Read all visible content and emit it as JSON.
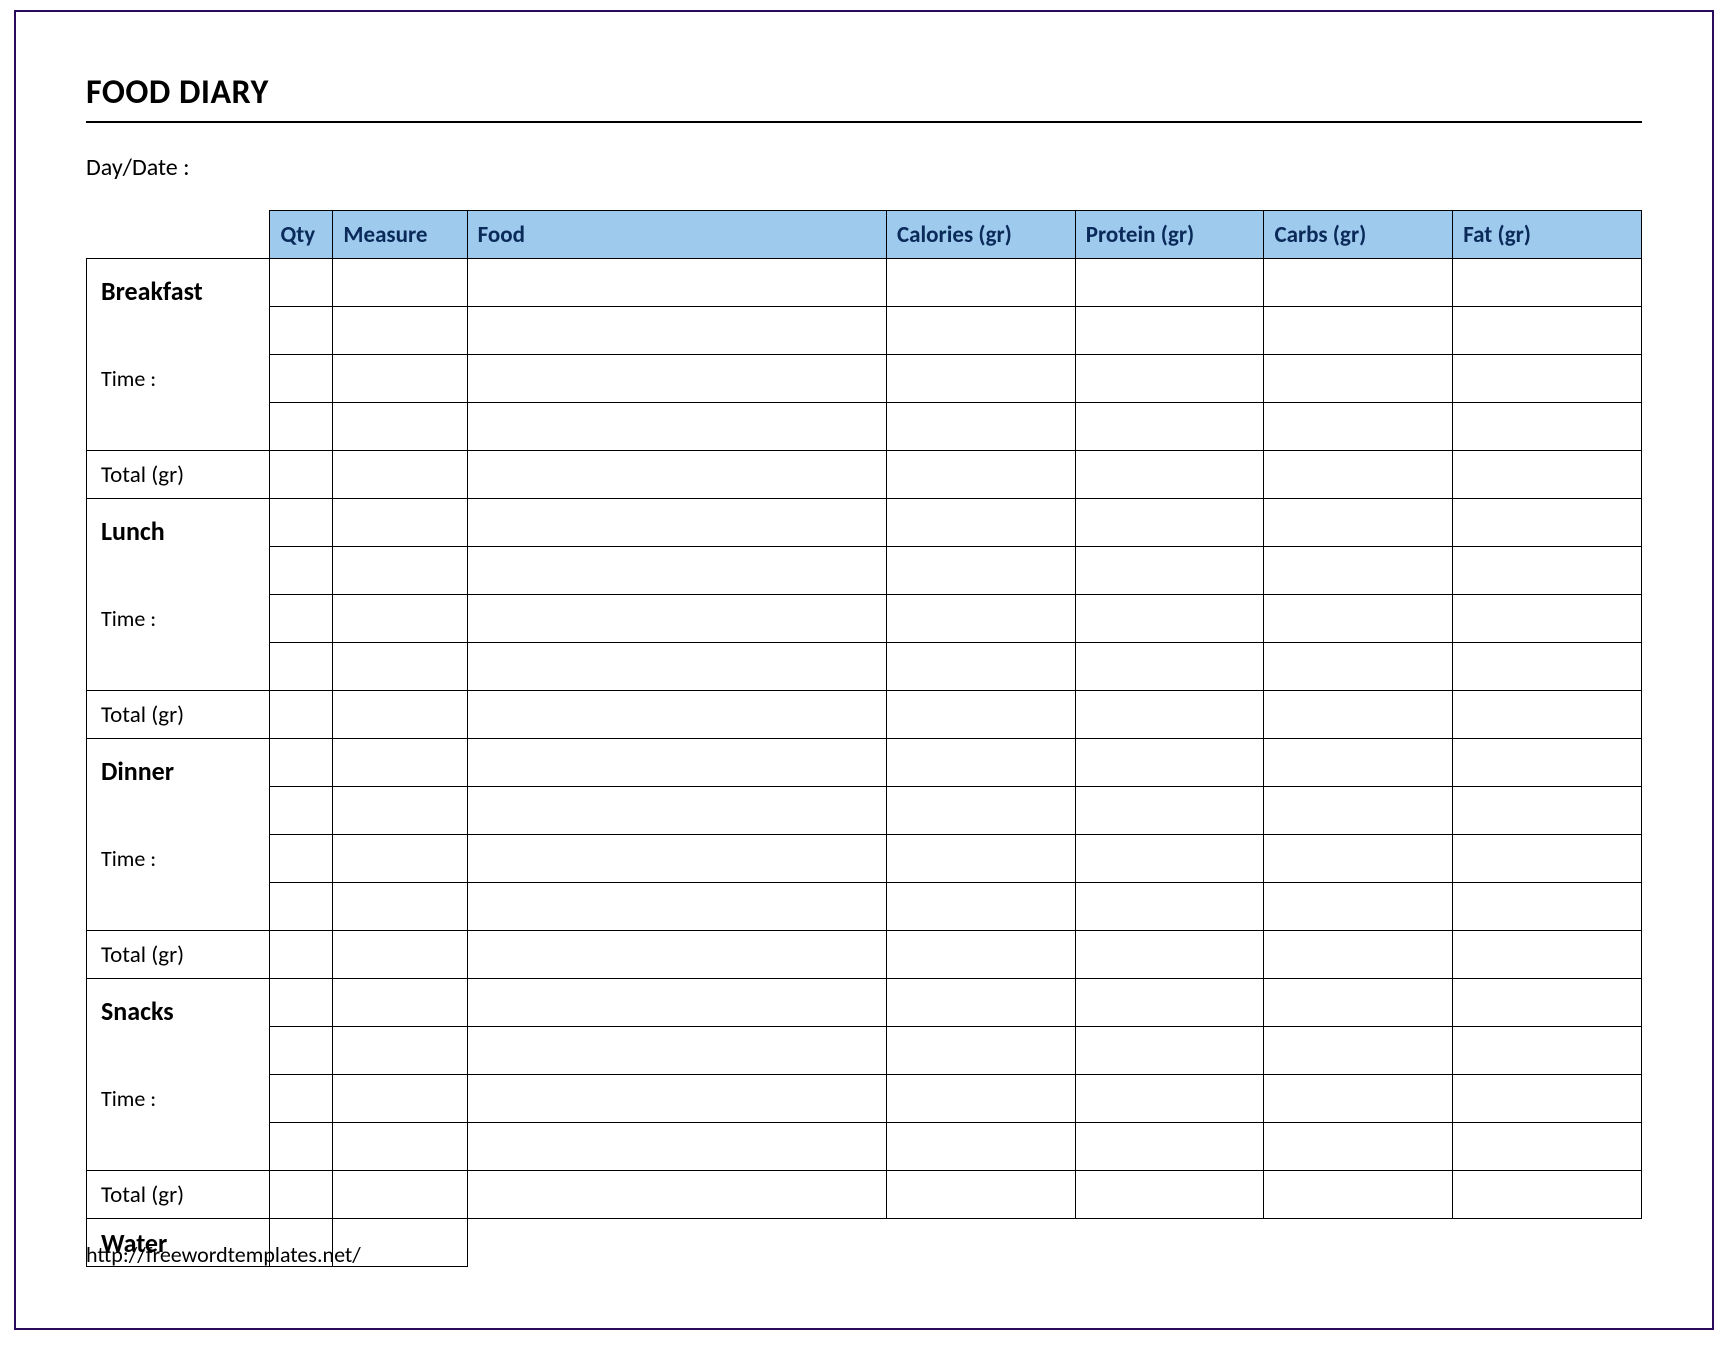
{
  "title": "FOOD DIARY",
  "daydate_label": "Day/Date :",
  "headers": {
    "qty": "Qty",
    "measure": "Measure",
    "food": "Food",
    "calories": "Calories (gr)",
    "protein": "Protein (gr)",
    "carbs": "Carbs (gr)",
    "fat": "Fat (gr)"
  },
  "meals": {
    "breakfast": {
      "name": "Breakfast",
      "time_label": "Time :",
      "total_label": "Total (gr)"
    },
    "lunch": {
      "name": "Lunch",
      "time_label": "Time :",
      "total_label": "Total (gr)"
    },
    "dinner": {
      "name": "Dinner",
      "time_label": "Time :",
      "total_label": "Total (gr)"
    },
    "snacks": {
      "name": "Snacks",
      "time_label": "Time :",
      "total_label": "Total (gr)"
    }
  },
  "water_label": "Water",
  "footer_url": "http://freewordtemplates.net/"
}
